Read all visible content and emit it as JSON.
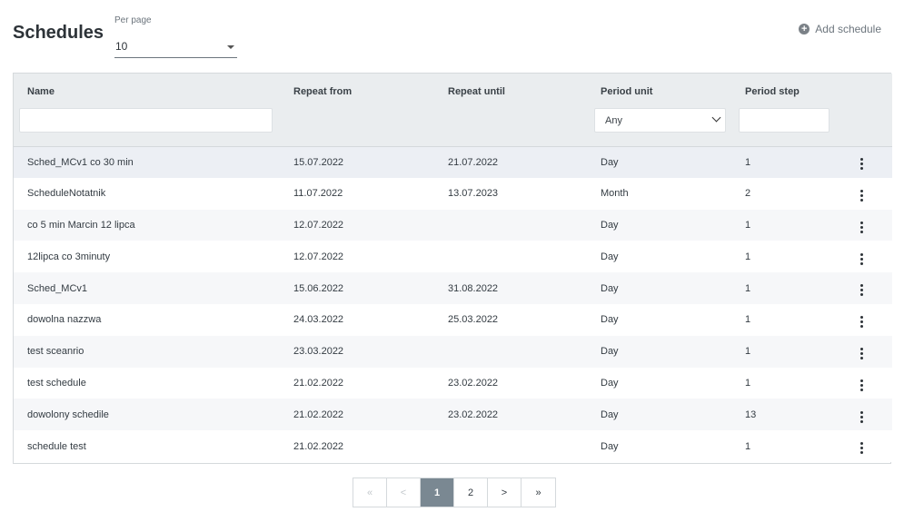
{
  "header": {
    "title": "Schedules",
    "per_page_label": "Per page",
    "per_page_value": "10",
    "add_label": "Add schedule",
    "add_icon": "plus-circle-icon"
  },
  "table": {
    "columns": [
      "Name",
      "Repeat from",
      "Repeat until",
      "Period unit",
      "Period step"
    ],
    "period_unit_filter": "Any",
    "rows": [
      {
        "name": "Sched_MCv1 co 30 min",
        "from": "15.07.2022",
        "until": "21.07.2022",
        "unit": "Day",
        "step": "1"
      },
      {
        "name": "ScheduleNotatnik",
        "from": "11.07.2022",
        "until": "13.07.2023",
        "unit": "Month",
        "step": "2"
      },
      {
        "name": "co 5 min Marcin 12 lipca",
        "from": "12.07.2022",
        "until": "",
        "unit": "Day",
        "step": "1"
      },
      {
        "name": "12lipca co 3minuty",
        "from": "12.07.2022",
        "until": "",
        "unit": "Day",
        "step": "1"
      },
      {
        "name": "Sched_MCv1",
        "from": "15.06.2022",
        "until": "31.08.2022",
        "unit": "Day",
        "step": "1"
      },
      {
        "name": "dowolna nazzwa",
        "from": "24.03.2022",
        "until": "25.03.2022",
        "unit": "Day",
        "step": "1"
      },
      {
        "name": "test sceanrio",
        "from": "23.03.2022",
        "until": "",
        "unit": "Day",
        "step": "1"
      },
      {
        "name": "test schedule",
        "from": "21.02.2022",
        "until": "23.02.2022",
        "unit": "Day",
        "step": "1"
      },
      {
        "name": "dowolony schedile",
        "from": "21.02.2022",
        "until": "23.02.2022",
        "unit": "Day",
        "step": "13"
      },
      {
        "name": "schedule test",
        "from": "21.02.2022",
        "until": "",
        "unit": "Day",
        "step": "1"
      }
    ]
  },
  "pagination": {
    "first": "«",
    "prev": "<",
    "pages": [
      "1",
      "2"
    ],
    "current": "1",
    "next": ">",
    "last": "»"
  }
}
